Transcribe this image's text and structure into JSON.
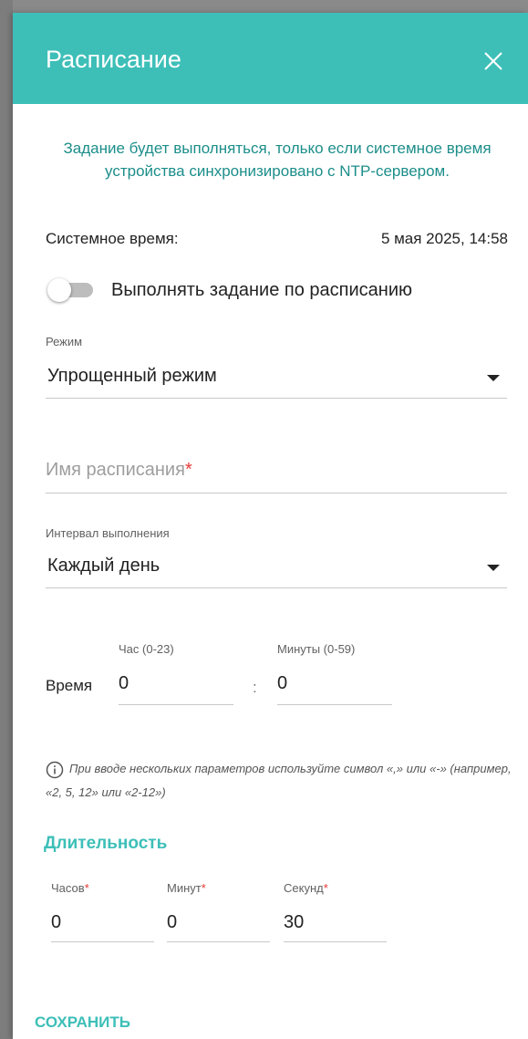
{
  "header": {
    "title": "Расписание"
  },
  "notice": "Задание будет выполняться, только если системное время устройства синхронизировано с NTP-сервером.",
  "system_time": {
    "label": "Системное время:",
    "value": "5 мая 2025, 14:58"
  },
  "schedule_toggle": {
    "label": "Выполнять задание по расписанию",
    "enabled": false
  },
  "mode": {
    "label": "Режим",
    "value": "Упрощенный режим"
  },
  "schedule_name": {
    "placeholder": "Имя расписания",
    "required_mark": "*",
    "value": ""
  },
  "interval": {
    "label": "Интервал выполнения",
    "value": "Каждый день"
  },
  "time": {
    "label": "Время",
    "hour_label": "Час (0-23)",
    "hour_value": "0",
    "separator": ":",
    "minute_label": "Минуты (0-59)",
    "minute_value": "0"
  },
  "hint": "При вводе нескольких параметров используйте символ «,» или «-» (например, «2, 5, 12» или «2-12»)",
  "duration": {
    "title": "Длительность",
    "hours_label": "Часов",
    "hours_value": "0",
    "minutes_label": "Минут",
    "minutes_value": "0",
    "seconds_label": "Секунд",
    "seconds_value": "30",
    "required_mark": "*"
  },
  "actions": {
    "save_label": "СОХРАНИТЬ"
  },
  "colors": {
    "accent": "#3dbfb8",
    "notice_text": "#1c8e8a",
    "required": "#e53935"
  },
  "icons": {
    "close": "close-icon",
    "dropdown": "chevron-down-icon",
    "info": "info-icon"
  }
}
